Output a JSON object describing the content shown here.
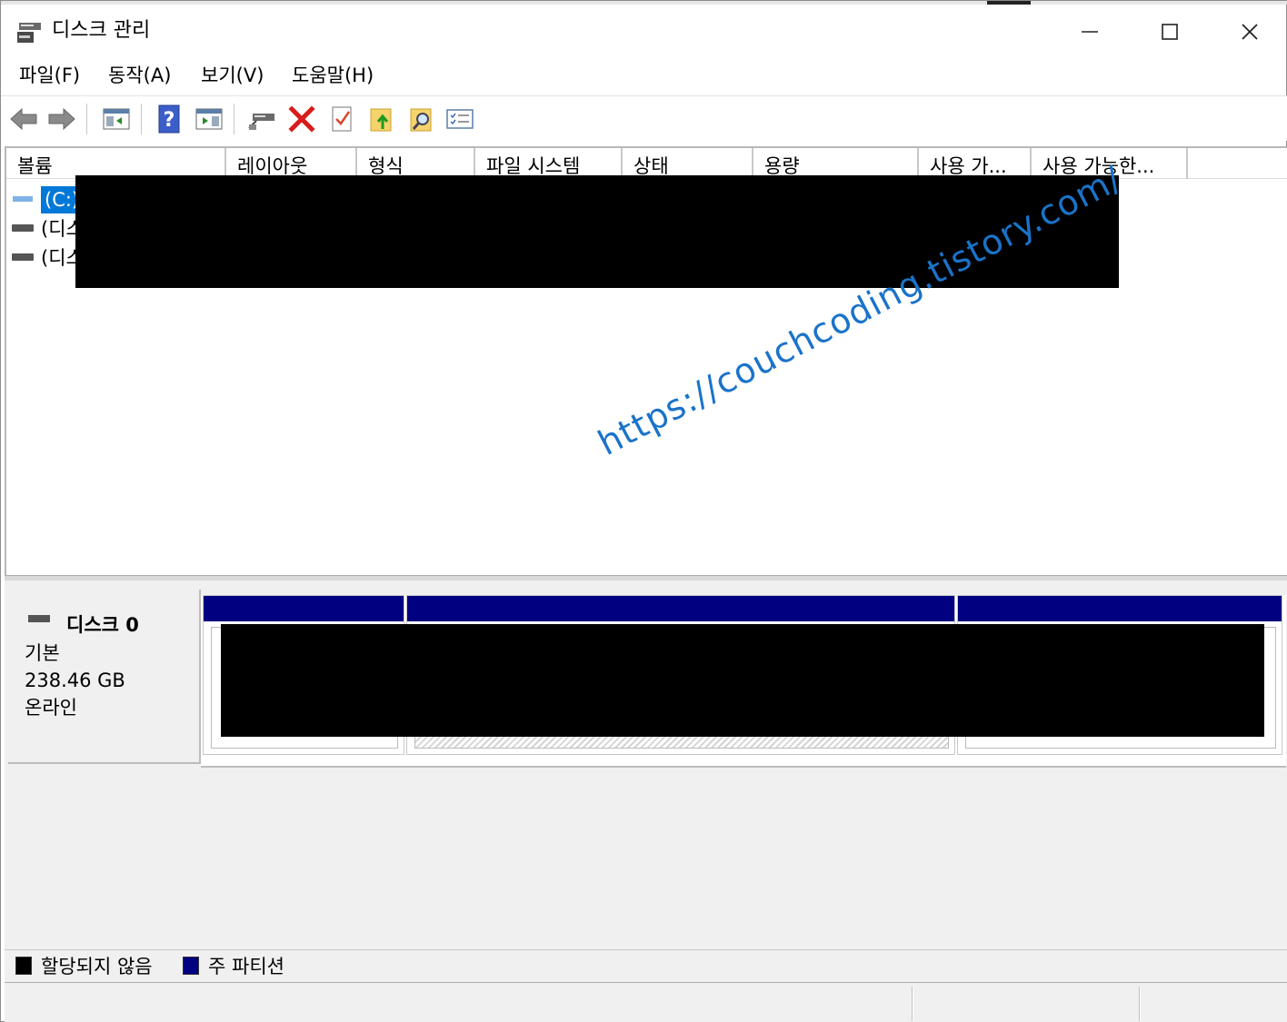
{
  "window": {
    "title": "디스크 관리",
    "minimize_glyph": "—",
    "maximize_glyph": "☐",
    "close_glyph": "✕"
  },
  "menu": [
    {
      "label": "파일(F)"
    },
    {
      "label": "동작(A)"
    },
    {
      "label": "보기(V)"
    },
    {
      "label": "도움말(H)"
    }
  ],
  "toolbar": {
    "icons": [
      "back-arrow-icon",
      "forward-arrow-icon",
      "console-tree-icon",
      "help-icon",
      "action-pane-icon",
      "connect-drive-icon",
      "delete-icon",
      "properties-check-icon",
      "folder-up-icon",
      "search-folder-icon",
      "list-view-icon"
    ]
  },
  "volume_table": {
    "columns": [
      "볼륨",
      "레이아웃",
      "형식",
      "파일 시스템",
      "상태",
      "용량",
      "사용 가...",
      "사용 가능한..."
    ],
    "rows": [
      {
        "label": "(C:)",
        "selected": true
      },
      {
        "label": "(디스",
        "selected": false
      },
      {
        "label": "(디스",
        "selected": false
      }
    ]
  },
  "watermark": "https://couchcoding.tistory.com/",
  "disk": {
    "name": "디스크 0",
    "type": "기본",
    "size": "238.46 GB",
    "status": "온라인"
  },
  "legend": [
    {
      "label": "할당되지 않음",
      "color": "#000000"
    },
    {
      "label": "주 파티션",
      "color": "#000080"
    }
  ],
  "colors": {
    "primary_partition": "#000080",
    "selection": "#0078d7",
    "watermark": "#1a73c9"
  }
}
